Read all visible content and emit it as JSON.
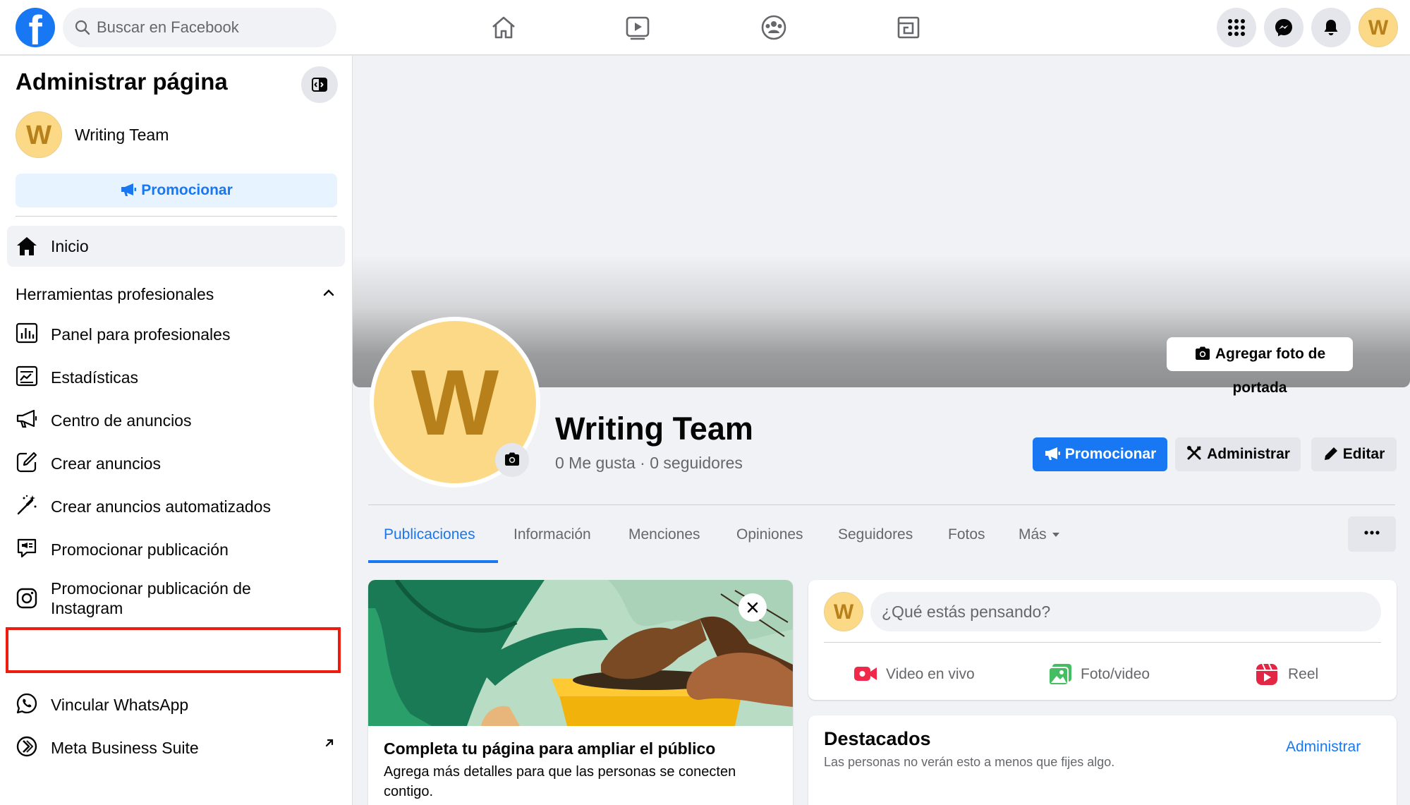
{
  "topbar": {
    "logo_letter": "f",
    "search_placeholder": "Buscar en Facebook",
    "avatar_letter": "W"
  },
  "sidebar": {
    "title": "Administrar página",
    "page_avatar_letter": "W",
    "page_name": "Writing Team",
    "promote_label": "Promocionar",
    "home_label": "Inicio",
    "section_title": "Herramientas profesionales",
    "items": [
      {
        "label": "Panel para profesionales",
        "icon": "dashboard-icon"
      },
      {
        "label": "Estadísticas",
        "icon": "insights-icon"
      },
      {
        "label": "Centro de anuncios",
        "icon": "megaphone-icon"
      },
      {
        "label": "Crear anuncios",
        "icon": "edit-icon"
      },
      {
        "label": "Crear anuncios automatizados",
        "icon": "magic-wand-icon"
      },
      {
        "label": "Promocionar publicación",
        "icon": "promote-post-icon"
      },
      {
        "label": "Promocionar publicación de Instagram",
        "icon": "instagram-icon"
      },
      {
        "label": "Vincular WhatsApp",
        "icon": "whatsapp-icon"
      },
      {
        "label": "Meta Business Suite",
        "icon": "meta-business-icon"
      }
    ]
  },
  "cover": {
    "add_cover_label": "Agregar foto de portada"
  },
  "profile": {
    "avatar_letter": "W",
    "name": "Writing Team",
    "stats": "0 Me gusta · 0 seguidores",
    "actions": {
      "promote": "Promocionar",
      "manage": "Administrar",
      "edit": "Editar"
    }
  },
  "tabs": [
    {
      "label": "Publicaciones",
      "active": true
    },
    {
      "label": "Información",
      "active": false
    },
    {
      "label": "Menciones",
      "active": false
    },
    {
      "label": "Opiniones",
      "active": false
    },
    {
      "label": "Seguidores",
      "active": false
    },
    {
      "label": "Fotos",
      "active": false
    },
    {
      "label": "Más",
      "active": false
    }
  ],
  "complete_card": {
    "title": "Completa tu página para ampliar el público",
    "description": "Agrega más detalles para que las personas se conecten contigo."
  },
  "composer": {
    "avatar_letter": "W",
    "placeholder": "¿Qué estás pensando?",
    "options": [
      {
        "label": "Video en vivo",
        "icon": "live-video-icon"
      },
      {
        "label": "Foto/video",
        "icon": "photo-video-icon"
      },
      {
        "label": "Reel",
        "icon": "reel-icon"
      }
    ]
  },
  "featured": {
    "title": "Destacados",
    "subtitle": "Las personas no verán esto a menos que fijes algo.",
    "manage_label": "Administrar"
  },
  "colors": {
    "brand": "#1877f2",
    "highlight_border": "#ee1c0e",
    "avatar_bg": "#fcd987",
    "avatar_fg": "#b8801a"
  }
}
